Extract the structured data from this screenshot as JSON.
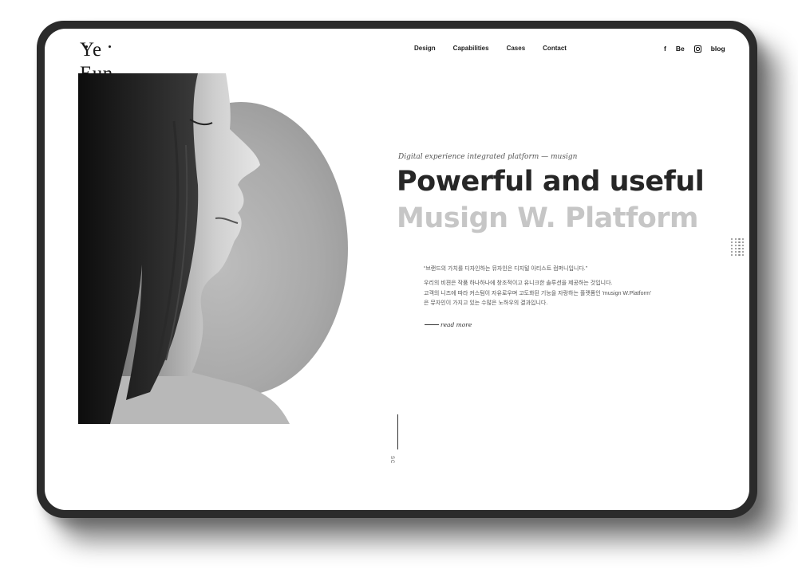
{
  "brand": {
    "logo_text": "Ye Eun"
  },
  "nav": {
    "items": [
      "Design",
      "Capabilities",
      "Cases",
      "Contact"
    ]
  },
  "social": {
    "facebook": "f",
    "behance": "Be",
    "instagram_icon": "instagram-icon",
    "blog": "blog"
  },
  "hero": {
    "tagline": "Digital experience integrated platform — musign",
    "headline": "Powerful and useful",
    "subheadline": "Musign W. Platform",
    "quote": "“브랜드의 가치를 디자인하는 뮤자인은 디지털 아티스트 컴퍼니입니다.”",
    "description": [
      "우리의 비젼은 작품 하나하나에 창조적이고 유니크한 솔루션을 제공하는 것입니다.",
      "고객의 니즈에 따라 커스텀이 자유로우며 고도화된 기능을 자랑하는 플랫폼인 'musign W.Platform'",
      "은 뮤자인이 가지고 있는 수많은 노하우의 결과입니다."
    ],
    "read_more": "read more"
  },
  "scroll": {
    "label": "SC"
  },
  "colors": {
    "device_frame": "#2b2b2b",
    "headline": "#262626",
    "subheadline": "#c6c6c6",
    "circle": "#a9a9a9"
  }
}
